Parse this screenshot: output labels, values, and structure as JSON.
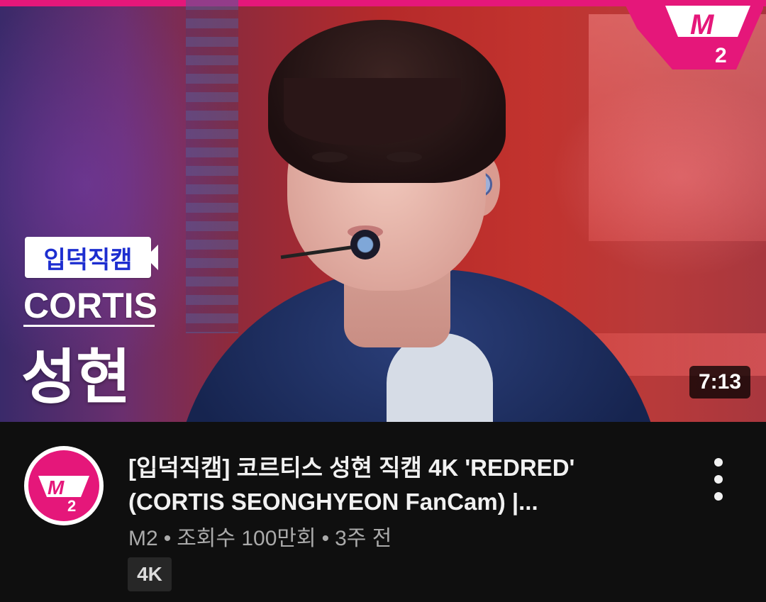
{
  "thumbnail": {
    "badge_label": "입덕직캠",
    "artist_label": "CORTIS",
    "member_label": "성현",
    "duration": "7:13",
    "channel_logo_text": "M2",
    "accent_color": "#e5177a"
  },
  "video": {
    "title_line1": "[입덕직캠] 코르티스 성현 직캠 4K 'REDRED'",
    "title_line2": "(CORTIS SEONGHYEON FanCam) |...",
    "channel_name": "M2",
    "views": "조회수 100만회",
    "uploaded": "3주 전",
    "separator": "•",
    "quality_badge": "4K"
  },
  "icons": {
    "avatar": "m2-logo-icon",
    "menu": "more-vert-icon"
  }
}
